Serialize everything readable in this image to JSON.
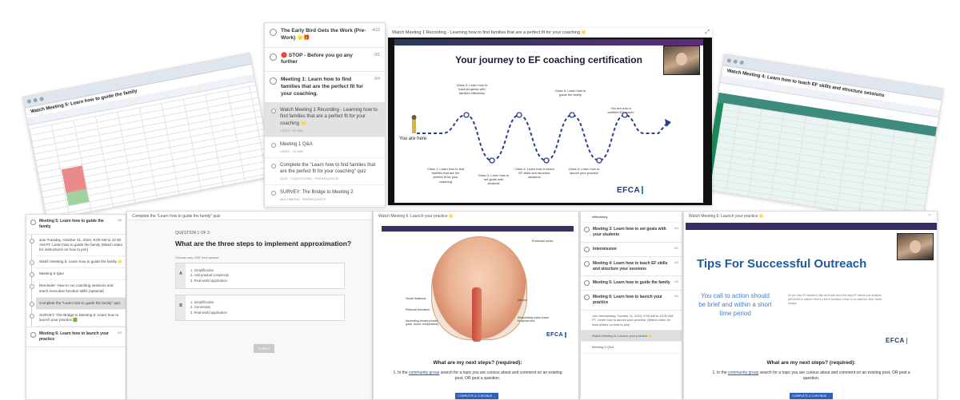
{
  "top_sidebar": {
    "sections": [
      {
        "title": "The Early Bird Gets the Work (Pre-Work) 🌟🎁",
        "count": "4/10"
      },
      {
        "title": "🔴 STOP - Before you go any further",
        "count": "0/1"
      },
      {
        "title": "Meeting 1: Learn how to find families that are the perfect fit for your coaching.",
        "count": "0/4"
      }
    ],
    "items": [
      {
        "text": "Watch Meeting 1 Recording - Learning how to find families that are a perfect fit for your coaching 🌟",
        "meta": "VIDEO · 52 MIN"
      },
      {
        "text": "Meeting 1 Q&A",
        "meta": "VIDEO · 24 MIN"
      },
      {
        "text": "Complete the \"Learn how to find families that are the perfect fit for your coaching\" quiz",
        "meta": "QUIZ · 3 QUESTIONS · PREREQUISITE"
      },
      {
        "text": "SURVEY: The Bridge to Meeting 2",
        "meta": "MULTIMEDIA · PREREQUISITE"
      }
    ]
  },
  "video_top": {
    "caption": "Watch Meeting 1 Recording - Learning how to find families that are a perfect fit for your coaching 🌟",
    "slide_title": "Your journey to EF coaching certification",
    "you_are_here": "You are here",
    "steps": [
      "Class 1: Learn how to find families that are the perfect fit for your coaching",
      "Class 2: Learn how to track progress with families effectively",
      "Class 3: Learn how to set goals with students",
      "Class 4: Learn how to teach EF skills and structure sessions",
      "Class 5: Learn how to guide the family",
      "Class 6: Learn how to launch your practice",
      "You are now a certified EF coach!"
    ],
    "logo": "EFCA"
  },
  "sheet_left": {
    "title": "Watch Meeting 5: Learn how to guide the family"
  },
  "sheet_right": {
    "title": "Watch Meeting 4: Learn how to teach EF skills and structure sessions"
  },
  "bottom_sidebar": {
    "section_title": "Meeting 5: Learn how to guide the family",
    "section_count": "0/6",
    "items": [
      "Join Tuesday, October 31, 2023, 9:00 AM to 10:30 AM PT: Learn how to guide the family (Watch video for instructions on how to join)",
      "Watch Meeting 5: Learn how to guide the family 🌟",
      "Meeting 5 Q&A",
      "Reminder: How to run coaching sessions and teach executive function skills (optional)",
      "Complete the \"Learn how to guide the family\" quiz",
      "SURVEY: The Bridge to Meeting 6: Learn how to launch your practice 🟩"
    ],
    "footer_title": "Meeting 6: Learn how to launch your practice",
    "footer_count": "0/3"
  },
  "quiz": {
    "header": "Complete the \"Learn how to guide the family\" quiz",
    "label": "QUESTION 1 OF 3",
    "question": "What are the three steps to implement approximation?",
    "hint": "Choose only ONE best answer.",
    "options": [
      {
        "letter": "A",
        "lines": [
          "1. Simplification",
          "2. Add gradual complexity",
          "3. Real-world application"
        ]
      },
      {
        "letter": "B",
        "lines": [
          "1. Simplification",
          "2. Generation",
          "3. Real-world application"
        ]
      }
    ],
    "submit": "SUBMIT"
  },
  "brain_lesson": {
    "caption": "Watch Meeting 6: Launch your practice 🌟",
    "labels": [
      "Prefrontal cortex",
      "Visual thalamus",
      "Reticular formation",
      "Ascending sensory tracts (pain, touch, temperature)",
      "Descending motor tracts to spinal cord",
      "Neuron"
    ],
    "logo": "EFCA",
    "next_title": "What are my next steps? (required):",
    "next_body_prefix": "1. In the",
    "next_body_link": "community group",
    "next_body_suffix": "search for a topic you are curious about and comment on an existing post, OR post a question.",
    "complete_btn": "COMPLETE & CONTINUE →"
  },
  "mid_sidebar": {
    "top_text": "effectively",
    "sections": [
      {
        "title": "Meeting 3: Learn how to set goals with your students",
        "count": "0/4"
      },
      {
        "title": "Intermission",
        "count": "0/1"
      },
      {
        "title": "Meeting 4: Learn how to teach EF skills and structure your sessions",
        "count": "0/4"
      },
      {
        "title": "Meeting 5: Learn how to guide the family",
        "count": "0/6"
      },
      {
        "title": "Meeting 6: Learn how to launch your practice",
        "count": "0/4"
      }
    ],
    "items": [
      "Join Wednesday, October 11, 2023, 9:00 AM to 10:30 AM PT: Learn how to launch your practice. (Watch video for instructions on how to join)",
      "Watch Meeting 6: Launch your practice 🌟",
      "Meeting 6 Q&A"
    ]
  },
  "outreach": {
    "caption": "Watch Meeting 6: Launch your practice 🌟",
    "title": "Tips For Successful Outreach",
    "body": "You call to action should be brief and within a short time period",
    "side_text": "Do you have 20 minutes to talk next week about the ways EF affects your students with ADHD or autism? Here's a link to schedule a time on my calendar. Best, Name Sample",
    "logo": "EFCA",
    "next_title": "What are my next steps? (required):",
    "next_body_prefix": "1. In the",
    "next_body_link": "community group",
    "next_body_suffix": "search for a topic you are curious about and comment on an existing post, OR post a question.",
    "complete_btn": "COMPLETE & CONTINUE →"
  },
  "colors": {
    "accent": "#2f5fb8",
    "slide_title": "#1e5aa0",
    "video_bar": "#3b2f63",
    "sheet_green": "#1b8a5a"
  }
}
